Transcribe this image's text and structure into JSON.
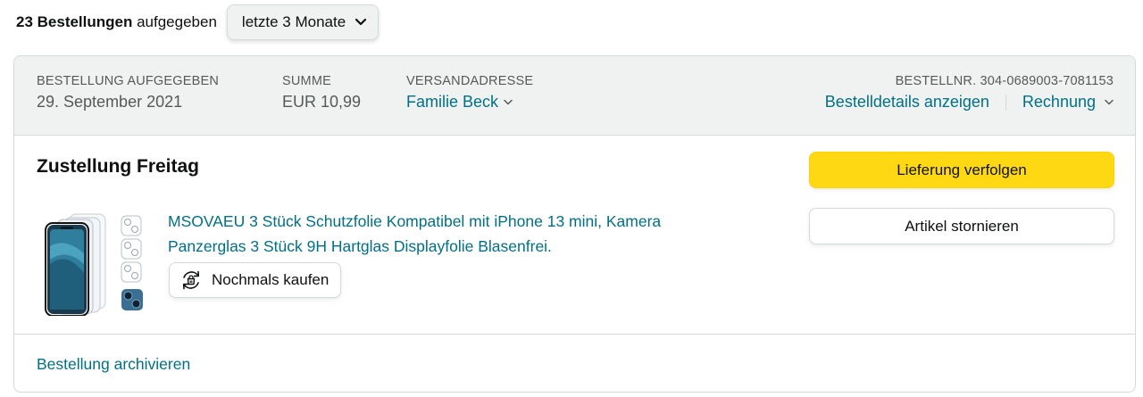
{
  "header": {
    "order_count_bold": "23 Bestellungen",
    "order_count_rest": " aufgegeben",
    "filter": {
      "selected": "letzte 3 Monate",
      "icon": "chevron-down-icon"
    }
  },
  "order": {
    "placed_label": "BESTELLUNG AUFGEGEBEN",
    "placed_date": "29. September 2021",
    "total_label": "SUMME",
    "total_value": "EUR 10,99",
    "shipto_label": "VERSANDADRESSE",
    "shipto_value": "Familie Beck",
    "order_number": "BESTELLNR. 304-0689003-7081153",
    "details_link": "Bestelldetails anzeigen",
    "invoice_link": "Rechnung",
    "delivery_status": "Zustellung Freitag",
    "product": {
      "title": "MSOVAEU 3 Stück Schutzfolie Kompatibel mit iPhone 13 mini, Kamera Panzerglas 3 Stück 9H Hartglas Displayfolie Blasenfrei.",
      "buy_again_label": "Nochmals kaufen",
      "buy_again_icon": "buy-again-icon",
      "thumbnail": "product-thumbnail"
    },
    "track_button": "Lieferung verfolgen",
    "cancel_button": "Artikel stornieren",
    "archive_link": "Bestellung archivieren"
  },
  "colors": {
    "link": "#007185",
    "primary_button": "#FFD814",
    "header_bg": "#F0F2F2",
    "border": "#D5D9D9"
  }
}
